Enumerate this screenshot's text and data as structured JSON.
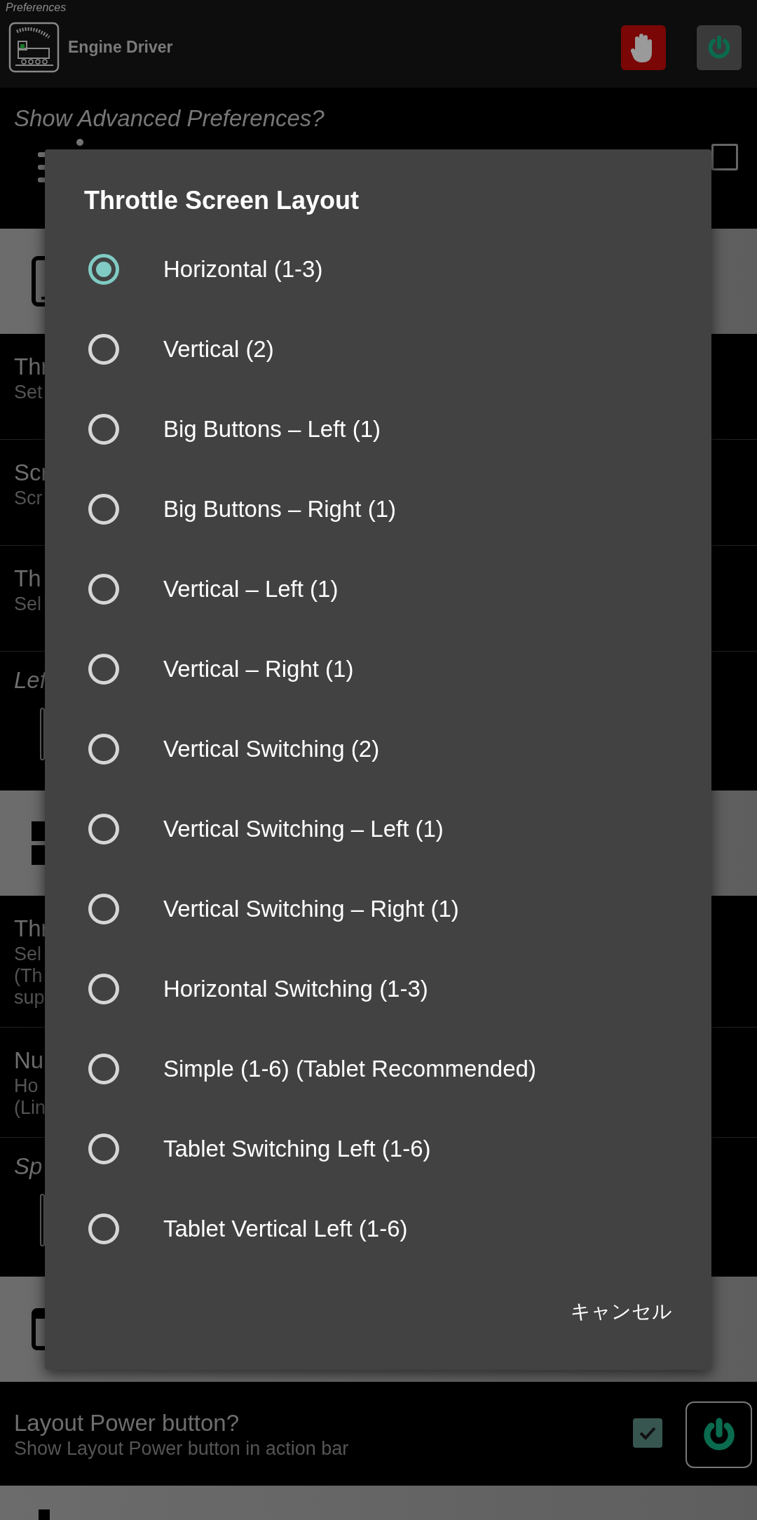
{
  "app_bar": {
    "subtitle": "Preferences",
    "title": "Engine Driver"
  },
  "advanced": {
    "title": "Show Advanced Preferences?",
    "checked": false
  },
  "rows": [
    {
      "kind": "band"
    },
    {
      "kind": "item",
      "title": "Thr",
      "summary": [
        "Set"
      ]
    },
    {
      "kind": "item",
      "title": "Scr",
      "summary": [
        "Scr"
      ]
    },
    {
      "kind": "item",
      "title": "Th",
      "summary": [
        "Sel"
      ]
    },
    {
      "kind": "field",
      "title": "Lef"
    },
    {
      "kind": "band"
    },
    {
      "kind": "item",
      "title": "Thr",
      "summary": [
        "Sel",
        "(Th",
        "sup"
      ]
    },
    {
      "kind": "item",
      "title": "Nu",
      "summary": [
        "Ho",
        "(Lin"
      ]
    },
    {
      "kind": "field",
      "title": "Sp"
    },
    {
      "kind": "band"
    },
    {
      "kind": "check",
      "title": "Layout Power button?",
      "summary": [
        "Show Layout Power button in action bar"
      ],
      "checked": true
    },
    {
      "kind": "band"
    }
  ],
  "dialog": {
    "title": "Throttle Screen Layout",
    "options": [
      {
        "label": "Horizontal (1-3)",
        "selected": true
      },
      {
        "label": "Vertical (2)",
        "selected": false
      },
      {
        "label": "Big Buttons – Left (1)",
        "selected": false
      },
      {
        "label": "Big Buttons – Right (1)",
        "selected": false
      },
      {
        "label": "Vertical – Left (1)",
        "selected": false
      },
      {
        "label": "Vertical – Right (1)",
        "selected": false
      },
      {
        "label": "Vertical Switching (2)",
        "selected": false
      },
      {
        "label": "Vertical Switching – Left (1)",
        "selected": false
      },
      {
        "label": "Vertical Switching – Right (1)",
        "selected": false
      },
      {
        "label": "Horizontal Switching (1-3)",
        "selected": false
      },
      {
        "label": "Simple (1-6) (Tablet Recommended)",
        "selected": false
      },
      {
        "label": "Tablet Switching Left (1-6)",
        "selected": false
      },
      {
        "label": "Tablet Vertical Left (1-6)",
        "selected": false
      }
    ],
    "buttons": [
      "キャンセル"
    ]
  }
}
